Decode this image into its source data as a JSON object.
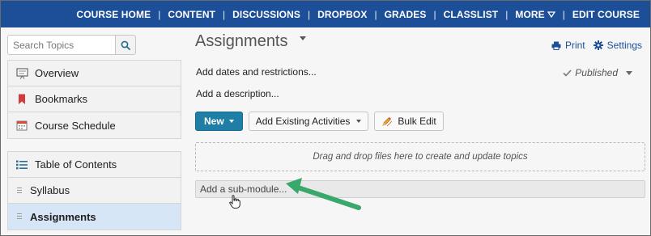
{
  "topnav": {
    "items": [
      {
        "label": "COURSE HOME"
      },
      {
        "label": "CONTENT"
      },
      {
        "label": "DISCUSSIONS"
      },
      {
        "label": "DROPBOX"
      },
      {
        "label": "GRADES"
      },
      {
        "label": "CLASSLIST"
      },
      {
        "label": "MORE"
      },
      {
        "label": "EDIT COURSE"
      }
    ],
    "separator": "|",
    "background": "#1d4f99"
  },
  "sidebar": {
    "search": {
      "placeholder": "Search Topics",
      "value": "",
      "button_icon": "search-icon"
    },
    "group1": [
      {
        "label": "Overview",
        "icon": "overview-icon"
      },
      {
        "label": "Bookmarks",
        "icon": "bookmark-icon"
      },
      {
        "label": "Course Schedule",
        "icon": "calendar-icon"
      }
    ],
    "group2": [
      {
        "label": "Table of Contents",
        "icon": "list-icon"
      },
      {
        "label": "Syllabus",
        "icon": "drag-handle-icon"
      },
      {
        "label": "Assignments",
        "icon": "drag-handle-icon",
        "active": true
      }
    ],
    "active_color": "#d6e6f7"
  },
  "main": {
    "title": "Assignments",
    "print_label": "Print",
    "settings_label": "Settings",
    "dates_link": "Add dates and restrictions...",
    "description_link": "Add a description...",
    "published_label": "Published",
    "buttons": {
      "new_label": "New",
      "add_existing_label": "Add Existing Activities",
      "bulk_edit_label": "Bulk Edit"
    },
    "dropzone_text": "Drag and drop files here to create and update topics",
    "submodule_placeholder": "Add a sub-module...",
    "primary_color": "#1f7ea5",
    "annotation_arrow_color": "#3aa86b"
  }
}
